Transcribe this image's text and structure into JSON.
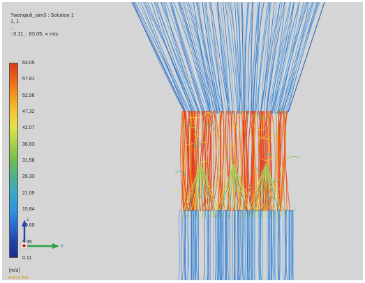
{
  "header": {
    "title": "?wenqiuli_sim3 : Solution 1",
    "line2": "1,  1",
    "line3": "...",
    "line4": ": 0.11,  : 63.05,  = m/s"
  },
  "legend": {
    "ticks": [
      "63.05",
      "57.81",
      "52.56",
      "47.32",
      "42.07",
      "36.83",
      "31.58",
      "26.33",
      "21.09",
      "15.84",
      "10.60",
      "5.35",
      "0.11"
    ],
    "min": 0.11,
    "max": 63.05,
    "units": "[m/s]",
    "colors": [
      "#d93a1c",
      "#ec6417",
      "#f39a1f",
      "#f5c835",
      "#dfe24a",
      "#a7d04c",
      "#6fbd4f",
      "#4fb08d",
      "#38a9c7",
      "#2f96dd",
      "#2a6fd4",
      "#2341a8",
      "#1d2b8f"
    ]
  },
  "brand": "ANSYS R15",
  "axes": {
    "z": "Z",
    "y": "Y"
  }
}
